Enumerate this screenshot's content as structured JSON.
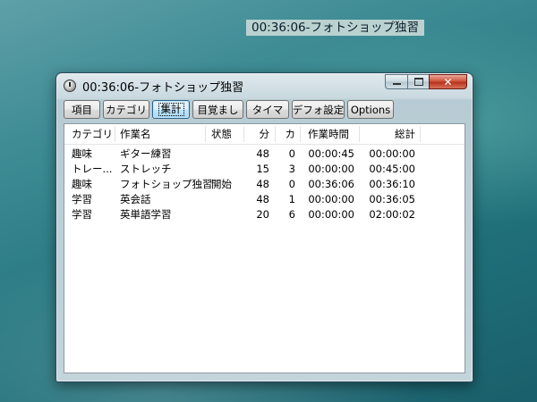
{
  "desktop": {
    "floating_clock": "00:36:06-フォトショップ独習"
  },
  "window": {
    "title": "00:36:06-フォトショップ独習",
    "controls": {
      "minimize": "",
      "maximize": "",
      "close": "✕"
    }
  },
  "toolbar": {
    "items": [
      "項目",
      "カテゴリ",
      "集計",
      "目覚まし",
      "タイマ",
      "デフォ設定",
      "Options"
    ],
    "active": "集計"
  },
  "table": {
    "columns": [
      "カテゴリ",
      "作業名",
      "状態",
      "分",
      "カ",
      "作業時間",
      "総計"
    ],
    "rows": [
      [
        "趣味",
        "ギター練習",
        "",
        "48",
        "0",
        "00:00:45",
        "00:00:00"
      ],
      [
        "トレー...",
        "ストレッチ",
        "",
        "15",
        "3",
        "00:00:00",
        "00:45:00"
      ],
      [
        "趣味",
        "フォトショップ独習",
        "開始",
        "48",
        "0",
        "00:36:06",
        "00:36:10"
      ],
      [
        "学習",
        "英会話",
        "",
        "48",
        "1",
        "00:00:00",
        "00:36:05"
      ],
      [
        "学習",
        "英単語学習",
        "",
        "20",
        "6",
        "00:00:00",
        "02:00:02"
      ]
    ]
  }
}
